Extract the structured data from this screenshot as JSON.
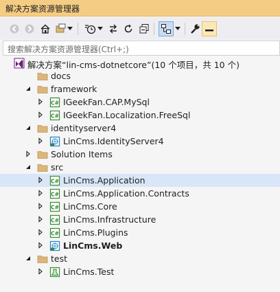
{
  "window": {
    "title": "解决方案资源管理器"
  },
  "toolbar": {
    "buttons": [
      {
        "name": "back-icon"
      },
      {
        "name": "forward-icon"
      },
      {
        "name": "home-icon"
      },
      {
        "name": "switch-views-icon"
      },
      {
        "name": "dropdown-icon"
      },
      {
        "name": "pending-changes-filter-icon"
      },
      {
        "name": "dropdown-icon"
      },
      {
        "name": "sync-icon"
      },
      {
        "name": "refresh-icon"
      },
      {
        "name": "collapse-all-icon"
      },
      {
        "name": "show-all-files-icon"
      },
      {
        "name": "dropdown-icon"
      },
      {
        "name": "properties-wrench-icon"
      },
      {
        "name": "preview-icon"
      }
    ]
  },
  "search": {
    "placeholder": "搜索解决方案资源管理器(Ctrl+;)"
  },
  "tree": [
    {
      "label": "解决方案“lin-cms-dotnetcore”(10 个项目，共 10 个)",
      "type": "solution",
      "level": 0,
      "expander": "none"
    },
    {
      "label": "docs",
      "type": "folder",
      "level": 1,
      "expander": "none"
    },
    {
      "label": "framework",
      "type": "folder",
      "level": 1,
      "expander": "expanded"
    },
    {
      "label": "IGeekFan.CAP.MySql",
      "type": "csproj",
      "level": 2,
      "expander": "collapsed"
    },
    {
      "label": "IGeekFan.Localization.FreeSql",
      "type": "csproj",
      "level": 2,
      "expander": "collapsed"
    },
    {
      "label": "identityserver4",
      "type": "folder",
      "level": 1,
      "expander": "expanded"
    },
    {
      "label": "LinCms.IdentityServer4",
      "type": "web",
      "level": 2,
      "expander": "collapsed"
    },
    {
      "label": "Solution Items",
      "type": "folder",
      "level": 1,
      "expander": "collapsed"
    },
    {
      "label": "src",
      "type": "folder",
      "level": 1,
      "expander": "expanded"
    },
    {
      "label": "LinCms.Application",
      "type": "csproj",
      "level": 2,
      "expander": "collapsed",
      "selected": true
    },
    {
      "label": "LinCms.Application.Contracts",
      "type": "csproj",
      "level": 2,
      "expander": "collapsed"
    },
    {
      "label": "LinCms.Core",
      "type": "csproj",
      "level": 2,
      "expander": "collapsed"
    },
    {
      "label": "LinCms.Infrastructure",
      "type": "csproj",
      "level": 2,
      "expander": "collapsed"
    },
    {
      "label": "LinCms.Plugins",
      "type": "csproj",
      "level": 2,
      "expander": "collapsed"
    },
    {
      "label": "LinCms.Web",
      "type": "web",
      "level": 2,
      "expander": "collapsed",
      "bold": true
    },
    {
      "label": "test",
      "type": "folder",
      "level": 1,
      "expander": "expanded"
    },
    {
      "label": "LinCms.Test",
      "type": "test",
      "level": 2,
      "expander": "collapsed"
    }
  ],
  "colors": {
    "title_bg": "#f5cc84",
    "toolbar_bg": "#eeeef2",
    "selection_bg": "#d8e6f8",
    "folder": "#dcb67a",
    "csharp": "#388a34",
    "web": "#1e7fc8",
    "solution": "#68217a"
  }
}
